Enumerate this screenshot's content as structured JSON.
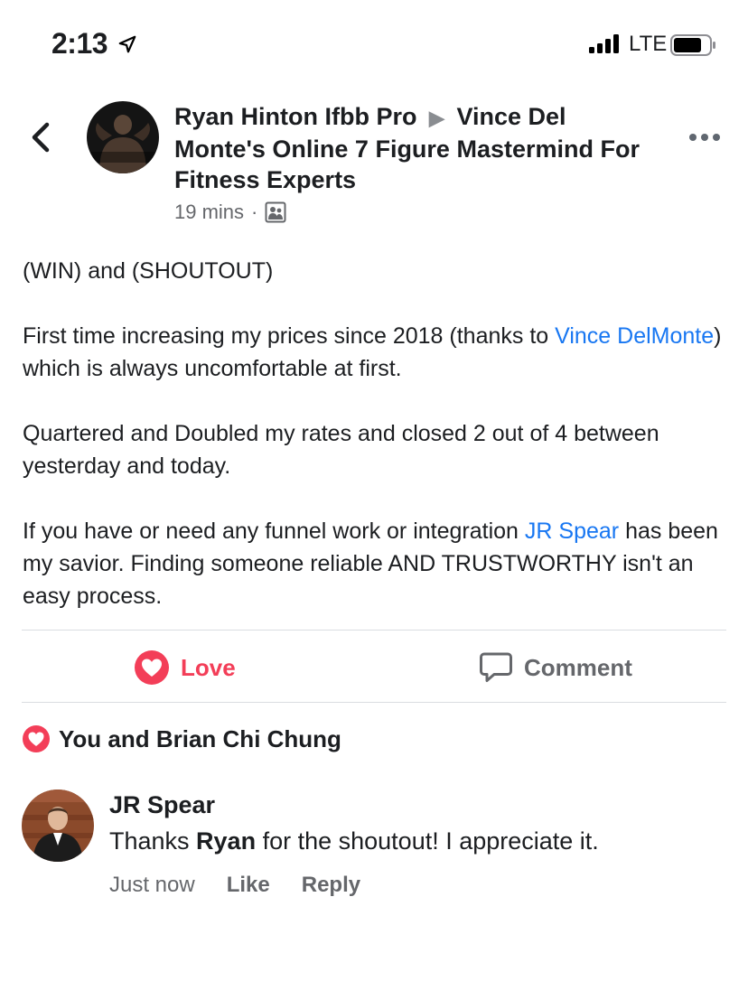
{
  "status_bar": {
    "time": "2:13",
    "network": "LTE",
    "icons": [
      "location-arrow-icon",
      "signal-icon",
      "battery-icon"
    ]
  },
  "header": {
    "back_icon": "chevron-left-icon",
    "author": "Ryan Hinton Ifbb Pro",
    "arrow": "▶",
    "group": "Vince Del Monte's Online 7 Figure Mastermind For Fitness Experts",
    "time": "19 mins",
    "separator": "·",
    "audience_icon": "group-icon",
    "more_icon": "more-dots-icon"
  },
  "post": {
    "line1": "(WIN) and (SHOUTOUT)",
    "p2_before": "First time increasing my prices since 2018 (thanks to ",
    "p2_link": "Vince DelMonte",
    "p2_after": ") which is always uncomfortable at first.",
    "p3": "Quartered and Doubled my rates and closed 2 out of 4 between yesterday and today.",
    "p4_before": "If you have or need any funnel work or integration ",
    "p4_link": "JR Spear",
    "p4_after": " has been my savior. Finding someone reliable AND TRUSTWORTHY isn't an easy process."
  },
  "actions": {
    "love_label": "Love",
    "comment_label": "Comment"
  },
  "reactions": {
    "text": "You and Brian Chi Chung"
  },
  "comment": {
    "author": "JR Spear",
    "text_before": "Thanks ",
    "text_bold": "Ryan",
    "text_after": " for the shoutout! I appreciate it.",
    "time": "Just now",
    "like_label": "Like",
    "reply_label": "Reply"
  },
  "colors": {
    "link": "#1877f2",
    "love": "#f33e58",
    "meta": "#65676b"
  }
}
